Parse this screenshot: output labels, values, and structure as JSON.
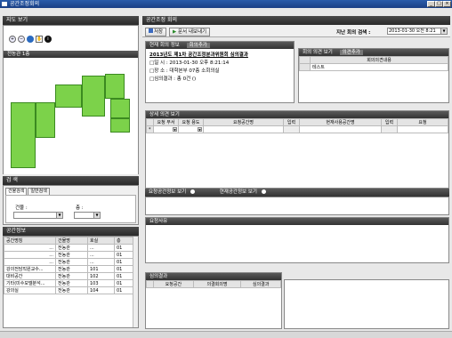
{
  "window": {
    "title": "공간조정회의",
    "min": "_",
    "max": "□",
    "close": "×"
  },
  "left": {
    "map_header": "지도 보기",
    "map_label": "전농관 1층",
    "search_header": "검 색",
    "search_tabs": [
      "건물검색",
      "일반검색"
    ],
    "building_label": "건물 :",
    "floor_label": "층 :",
    "space_header": "공간정보",
    "space_columns": [
      "공간명칭",
      "건물명",
      "호실",
      "층"
    ],
    "space_rows": [
      [
        "...",
        "전농관",
        "...",
        "01"
      ],
      [
        "...",
        "전농관",
        "...",
        "01"
      ],
      [
        "...",
        "전농관",
        "...",
        "01"
      ],
      [
        "강의전담직원교수...",
        "전농관",
        "101",
        "01"
      ],
      [
        "대비공간",
        "전농관",
        "102",
        "01"
      ],
      [
        "기타(미수모델분석...",
        "전농관",
        "103",
        "01"
      ],
      [
        "강의실",
        "전농관",
        "104",
        "01"
      ]
    ]
  },
  "right": {
    "header": "공간조정 회의",
    "save_label": "저장",
    "export_label": "문서 내보내기",
    "search_label": "지난 회의 검색 :",
    "search_value": "2013-01-30 오전 8:21",
    "tab_current": "현재 회의 정보",
    "tab_add": "회의추가",
    "meeting_title": "2013년도 제1차 공간조정분과위원회 심의결과",
    "meeting_date": "□일    시 : 2013-01-30 오후 8:21:14",
    "meeting_place": "□장    소 : 대학본부 07층 소회의실",
    "meeting_result": "□심의결과 : 총 0건 ()",
    "opinion_tab": "회의 의견 보기",
    "opinion_add": "의견추가",
    "opinion_col": "회의의견내용",
    "opinion_row": "테스트",
    "detail_header": "상세 의견 보기",
    "detail_columns": [
      "요청 부서",
      "요청 용도",
      "요청공간명",
      "입력",
      "현재사용공간명",
      "입력",
      "요청"
    ],
    "detail_row_marker": "*",
    "radio_request": "요청공간정보 보기",
    "radio_current": "현재공간정보 보기",
    "reason_header": "요청사유",
    "review_header": "심의결과",
    "review_columns": [
      "요청공간",
      "의결회의명",
      "심의결과"
    ]
  }
}
